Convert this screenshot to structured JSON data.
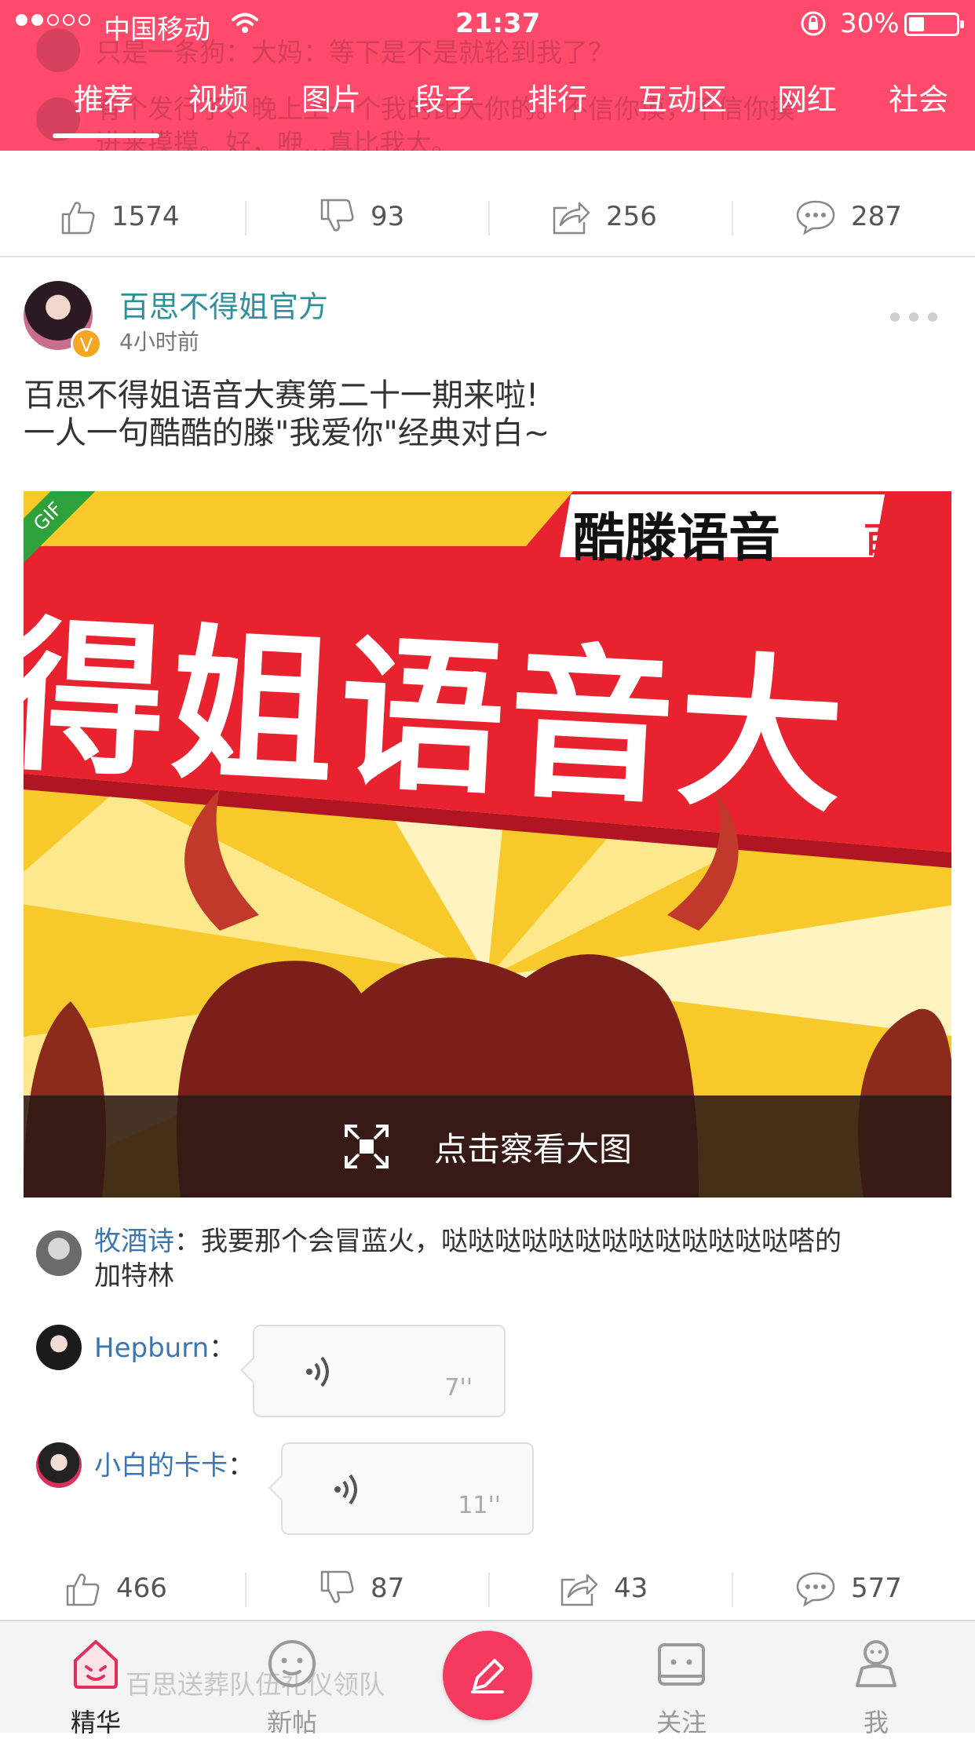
{
  "status_bar": {
    "carrier": "中国移动",
    "time": "21:37",
    "battery_percent": "30%",
    "battery_level": 0.3
  },
  "behind_text": {
    "line1": "只是一条狗：大妈：等下是不是就轮到我了？",
    "line2": "有个发行子、晚上上一个我的比大你的。不信你摸，不信你摸",
    "line3": "进来摸摸。好，咿...真比我大。",
    "bottom_line": "百思送葬队伍礼仪领队"
  },
  "tabs": [
    "推荐",
    "视频",
    "图片",
    "段子",
    "排行",
    "互动区",
    "网红",
    "社会"
  ],
  "active_tab": 0,
  "top_actions": {
    "like": "1574",
    "dislike": "93",
    "share": "256",
    "comment": "287"
  },
  "post": {
    "author": "百思不得姐官方",
    "time": "4小时前",
    "text_line1": "百思不得姐语音大赛第二十一期来啦!",
    "text_line2": "一人一句酷酷的滕\"我爱你\"经典对白~",
    "gif_badge": "GIF",
    "banner_top": "酷滕语音",
    "banner_corner": "百思",
    "banner_main": "得姐语音大",
    "view_large": "点击察看大图",
    "comments": [
      {
        "name": "牧酒诗",
        "sep": "：",
        "text": "我要那个会冒蓝火，哒哒哒哒哒哒哒哒哒哒哒哒哒嗒的",
        "text2": "加特林"
      },
      {
        "name": "Hepburn",
        "sep": "：",
        "voice": "7''"
      },
      {
        "name": "小白的卡卡",
        "sep": "：",
        "voice": "11''"
      }
    ],
    "actions": {
      "like": "466",
      "dislike": "87",
      "share": "43",
      "comment": "577"
    }
  },
  "bottom_nav": {
    "items": [
      "精华",
      "新帖",
      "关注",
      "我"
    ],
    "active": 0
  },
  "colors": {
    "brand": "#ff4a6b",
    "author_teal": "#2f8f9d",
    "comment_name": "#3b76b1",
    "compose": "#f53a5f"
  }
}
